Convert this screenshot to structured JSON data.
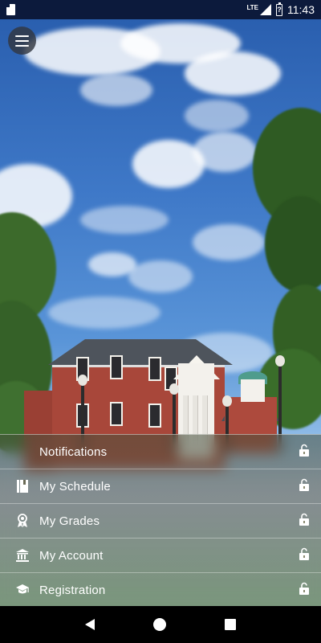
{
  "status_bar": {
    "network": "LTE",
    "battery_level": "?",
    "time": "11:43"
  },
  "menu": {
    "open_icon": "hamburger-menu-icon",
    "items": [
      {
        "label": "Notifications",
        "icon": "",
        "lock": "lock-icon"
      },
      {
        "label": "My Schedule",
        "icon": "schedule-book-icon",
        "lock": "lock-icon"
      },
      {
        "label": "My Grades",
        "icon": "award-ribbon-icon",
        "lock": "lock-icon"
      },
      {
        "label": "My Account",
        "icon": "bank-building-icon",
        "lock": "lock-icon"
      },
      {
        "label": "Registration",
        "icon": "graduation-cap-icon",
        "lock": "lock-icon"
      }
    ]
  },
  "nav_bar": {
    "back": "back-triangle-icon",
    "home": "home-circle-icon",
    "recent": "recent-apps-square-icon"
  },
  "colors": {
    "status_bar_bg": "#0c1a3c",
    "menu_text": "#ffffff",
    "sky": "#3f79c8"
  }
}
